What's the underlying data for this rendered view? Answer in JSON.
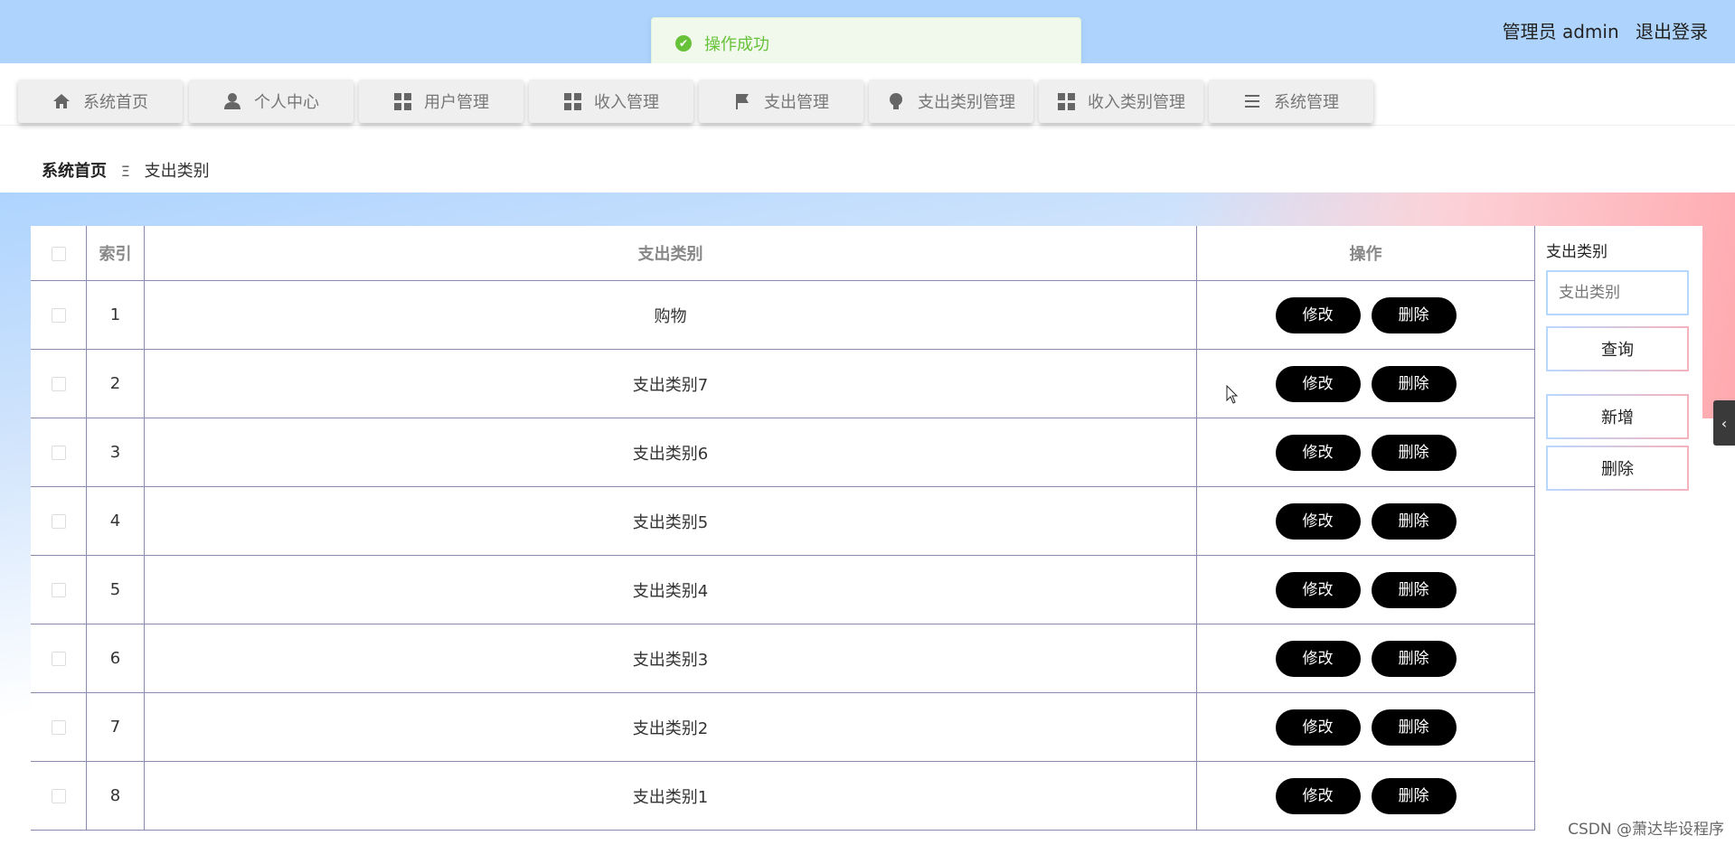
{
  "header": {
    "user_label": "管理员 admin",
    "logout_label": "退出登录"
  },
  "toast": {
    "message": "操作成功",
    "icon": "check-circle-icon"
  },
  "nav": {
    "items": [
      {
        "label": "系统首页",
        "icon": "home-icon"
      },
      {
        "label": "个人中心",
        "icon": "user-icon"
      },
      {
        "label": "用户管理",
        "icon": "grid-icon"
      },
      {
        "label": "收入管理",
        "icon": "grid-icon"
      },
      {
        "label": "支出管理",
        "icon": "flag-icon"
      },
      {
        "label": "支出类别管理",
        "icon": "bulb-icon"
      },
      {
        "label": "收入类别管理",
        "icon": "grid-icon"
      },
      {
        "label": "系统管理",
        "icon": "list-icon"
      }
    ]
  },
  "breadcrumb": {
    "home": "系统首页",
    "separator": "Ξ",
    "current": "支出类别"
  },
  "table": {
    "headers": {
      "index": "索引",
      "category": "支出类别",
      "action": "操作"
    },
    "edit_label": "修改",
    "delete_label": "删除",
    "rows": [
      {
        "index": "1",
        "category": "购物"
      },
      {
        "index": "2",
        "category": "支出类别7"
      },
      {
        "index": "3",
        "category": "支出类别6"
      },
      {
        "index": "4",
        "category": "支出类别5"
      },
      {
        "index": "5",
        "category": "支出类别4"
      },
      {
        "index": "6",
        "category": "支出类别3"
      },
      {
        "index": "7",
        "category": "支出类别2"
      },
      {
        "index": "8",
        "category": "支出类别1"
      }
    ]
  },
  "search": {
    "label": "支出类别",
    "placeholder": "支出类别",
    "query_label": "查询",
    "add_label": "新增",
    "delete_label": "删除"
  },
  "watermark": "CSDN @萧达毕设程序",
  "colors": {
    "topbar": "#aed4fe",
    "toast_green": "#67c23a",
    "button_black": "#000000"
  }
}
